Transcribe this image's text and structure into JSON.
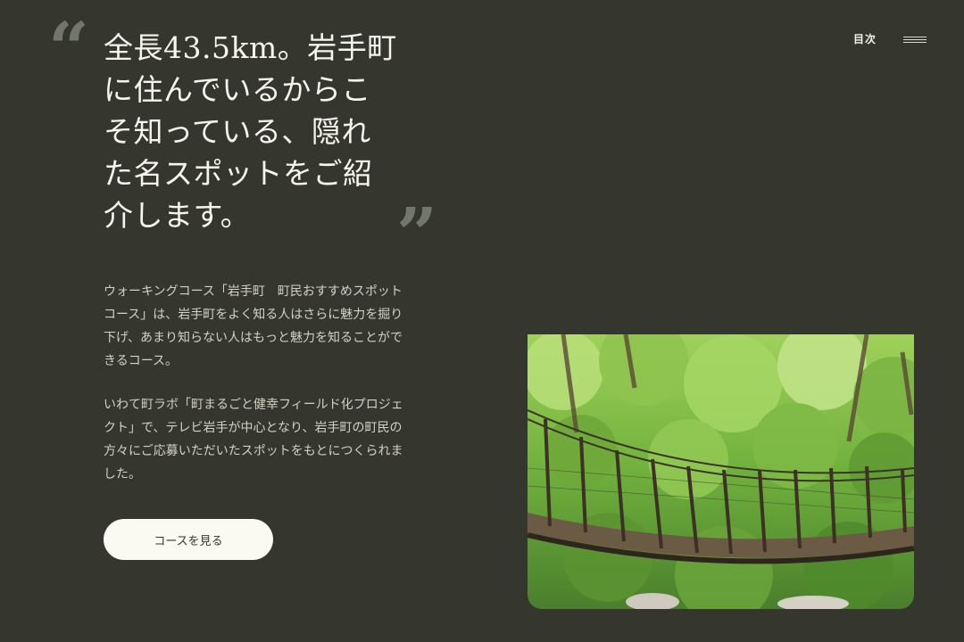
{
  "hero": {
    "quote_open": "“",
    "quote_close": "”",
    "headline": "全長43.5km。岩手町に住んでいるからこそ知っている、隠れた名スポットをご紹介します。",
    "paragraph_1": "ウォーキングコース「岩手町　町民おすすめスポットコース」は、岩手町をよく知る人はさらに魅力を掘り下げ、あまり知らない人はもっと魅力を知ることができるコース。",
    "paragraph_2": "いわて町ラボ「町まるごと健幸フィールド化プロジェクト」で、テレビ岩手が中心となり、岩手町の町民の方々にご応募いただいたスポットをもとにつくられました。",
    "button_label": "コースを見る"
  },
  "nav": {
    "toc_label": "目次",
    "menu_icon": "hamburger-menu-icon"
  },
  "image": {
    "subject": "suspension-bridge-in-forest"
  },
  "colors": {
    "background": "#35362e",
    "button_bg": "#fbfaf0",
    "quote_mark": "#73766a",
    "body_text": "#d2d1c4"
  }
}
